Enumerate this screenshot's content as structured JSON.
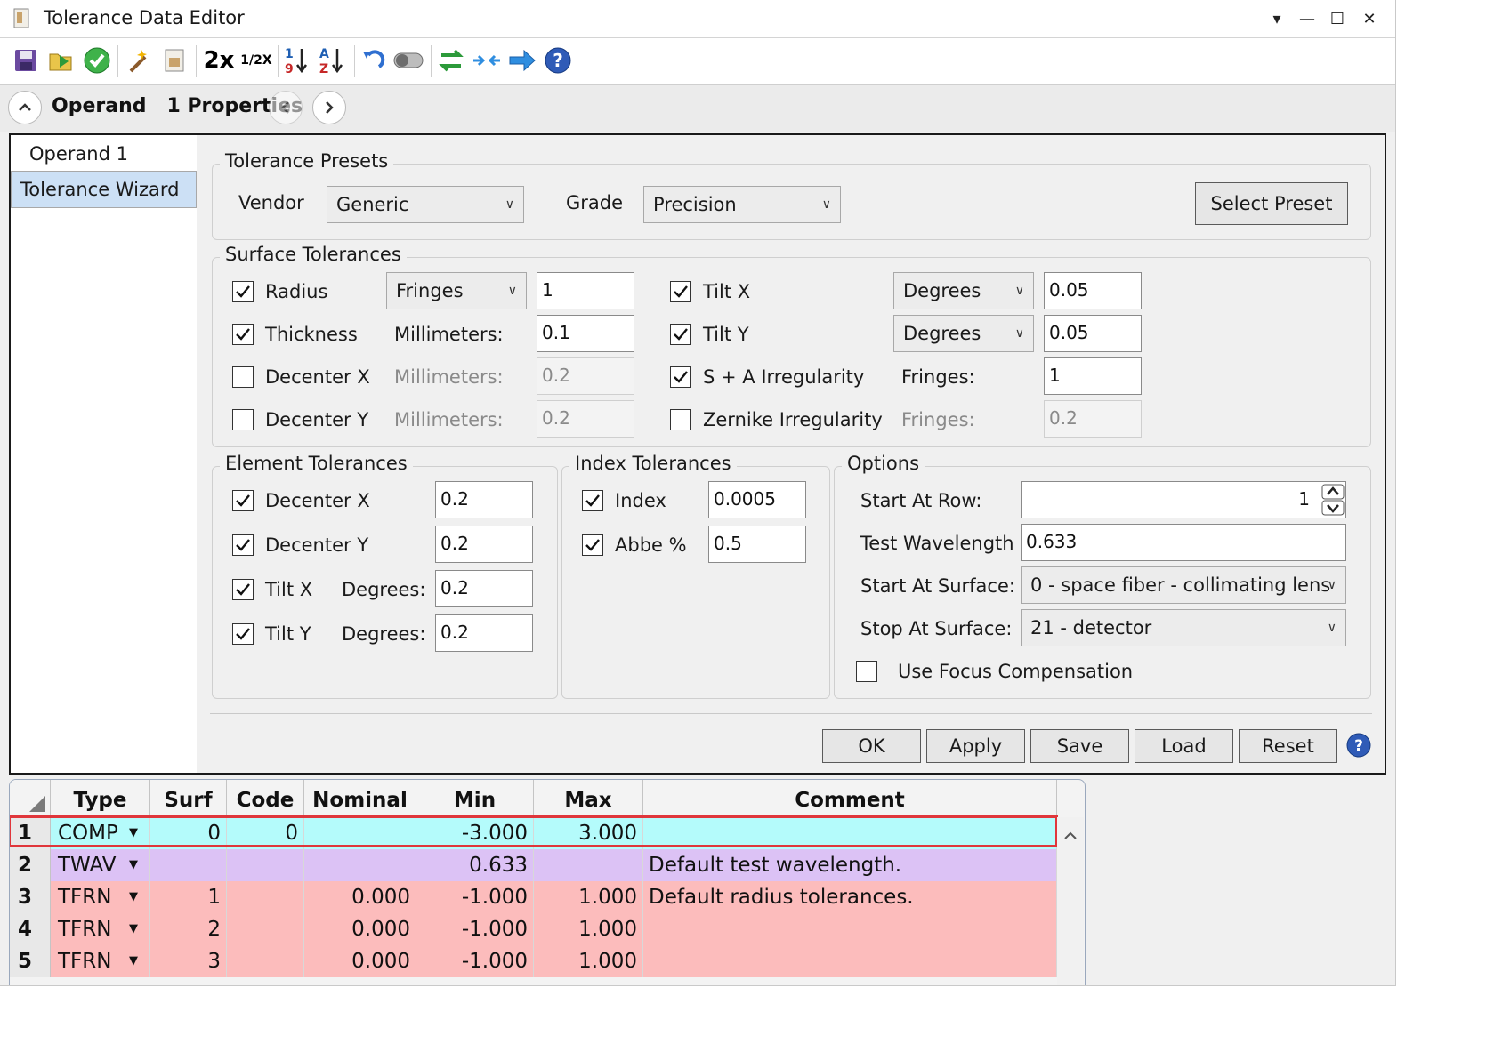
{
  "window": {
    "title": "Tolerance Data Editor",
    "controls": {
      "dropdown": "▾",
      "minimize": "—",
      "maximize": "☐",
      "close": "✕"
    }
  },
  "toolbar": {
    "zoom_in_label": "2x",
    "zoom_half_label": "1/2X",
    "sort_num_label": [
      "1",
      "9"
    ],
    "sort_alpha_label": [
      "A",
      "Z"
    ]
  },
  "operand_bar": {
    "title": "Operand   1 Properties"
  },
  "nav": {
    "items": [
      {
        "label": "Operand 1",
        "selected": false
      },
      {
        "label": "Tolerance Wizard",
        "selected": true
      }
    ]
  },
  "presets": {
    "legend": "Tolerance Presets",
    "vendor_label": "Vendor",
    "vendor_value": "Generic",
    "grade_label": "Grade",
    "grade_value": "Precision",
    "select_button": "Select Preset"
  },
  "surface": {
    "legend": "Surface Tolerances",
    "radius": {
      "label": "Radius",
      "checked": true,
      "unit": "Fringes",
      "value": "1"
    },
    "thickness": {
      "label": "Thickness",
      "checked": true,
      "unit": "Millimeters:",
      "value": "0.1"
    },
    "decenter_x": {
      "label": "Decenter X",
      "checked": false,
      "unit": "Millimeters:",
      "value": "0.2"
    },
    "decenter_y": {
      "label": "Decenter Y",
      "checked": false,
      "unit": "Millimeters:",
      "value": "0.2"
    },
    "tilt_x": {
      "label": "Tilt X",
      "checked": true,
      "unit": "Degrees",
      "value": "0.05"
    },
    "tilt_y": {
      "label": "Tilt Y",
      "checked": true,
      "unit": "Degrees",
      "value": "0.05"
    },
    "sa_irr": {
      "label": "S + A Irregularity",
      "checked": true,
      "unit": "Fringes:",
      "value": "1"
    },
    "zern_irr": {
      "label": "Zernike Irregularity",
      "checked": false,
      "unit": "Fringes:",
      "value": "0.2"
    }
  },
  "element": {
    "legend": "Element Tolerances",
    "decenter_x": {
      "label": "Decenter X",
      "checked": true,
      "value": "0.2"
    },
    "decenter_y": {
      "label": "Decenter Y",
      "checked": true,
      "value": "0.2"
    },
    "tilt_x": {
      "label": "Tilt X",
      "checked": true,
      "unit": "Degrees:",
      "value": "0.2"
    },
    "tilt_y": {
      "label": "Tilt Y",
      "checked": true,
      "unit": "Degrees:",
      "value": "0.2"
    }
  },
  "index": {
    "legend": "Index Tolerances",
    "index": {
      "label": "Index",
      "checked": true,
      "value": "0.0005"
    },
    "abbe": {
      "label": "Abbe %",
      "checked": true,
      "value": "0.5"
    }
  },
  "options": {
    "legend": "Options",
    "start_row_label": "Start At Row:",
    "start_row_value": "1",
    "test_wl_label": "Test Wavelength",
    "test_wl_value": "0.633",
    "start_surf_label": "Start At Surface:",
    "start_surf_value": "0 - space fiber - collimating lens",
    "stop_surf_label": "Stop At Surface:",
    "stop_surf_value": "21 - detector",
    "focus_comp_label": "Use Focus Compensation",
    "focus_comp_checked": false
  },
  "actions": {
    "ok": "OK",
    "apply": "Apply",
    "save": "Save",
    "load": "Load",
    "reset": "Reset"
  },
  "table": {
    "headers": [
      "Type",
      "Surf",
      "Code",
      "Nominal",
      "Min",
      "Max",
      "Comment"
    ],
    "rows": [
      {
        "num": "1",
        "type": "COMP",
        "surf": "0",
        "code": "0",
        "nominal": "",
        "min": "-3.000",
        "max": "3.000",
        "comment": "",
        "color": "#b4fbfb",
        "selected": true
      },
      {
        "num": "2",
        "type": "TWAV",
        "surf": "",
        "code": "",
        "nominal": "",
        "min": "0.633",
        "max": "",
        "comment": "Default test wavelength.",
        "color": "#dcc2f5",
        "selected": false
      },
      {
        "num": "3",
        "type": "TFRN",
        "surf": "1",
        "code": "",
        "nominal": "0.000",
        "min": "-1.000",
        "max": "1.000",
        "comment": "Default radius tolerances.",
        "color": "#fcbcbc",
        "selected": false
      },
      {
        "num": "4",
        "type": "TFRN",
        "surf": "2",
        "code": "",
        "nominal": "0.000",
        "min": "-1.000",
        "max": "1.000",
        "comment": "",
        "color": "#fcbcbc",
        "selected": false
      },
      {
        "num": "5",
        "type": "TFRN",
        "surf": "3",
        "code": "",
        "nominal": "0.000",
        "min": "-1.000",
        "max": "1.000",
        "comment": "",
        "color": "#fcbcbc",
        "selected": false
      }
    ]
  },
  "colors": {
    "selection_outline": "#e0363b",
    "nav_selected": "#cce0f5",
    "help_blue": "#2f5bb7"
  }
}
